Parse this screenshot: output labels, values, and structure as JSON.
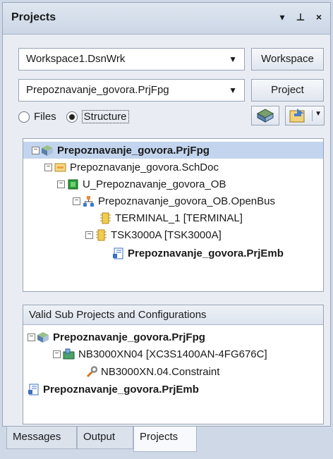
{
  "panel": {
    "title": "Projects",
    "buttons": {
      "menu": "▾",
      "pin": "⊥",
      "close": "×"
    }
  },
  "workspace": {
    "value": "Workspace1.DsnWrk",
    "button": "Workspace"
  },
  "project": {
    "value": "Prepoznavanje_govora.PrjFpg",
    "button": "Project"
  },
  "view": {
    "files_label": "Files",
    "structure_label": "Structure",
    "selected": "Structure"
  },
  "tree": [
    {
      "label": "Prepoznavanje_govora.PrjFpg",
      "bold": true,
      "selected": true,
      "icon": "fpga-project-icon"
    },
    {
      "label": "Prepoznavanje_govora.SchDoc",
      "icon": "schematic-icon"
    },
    {
      "label": "U_Prepoznavanje_govora_OB",
      "icon": "component-icon"
    },
    {
      "label": "Prepoznavanje_govora_OB.OpenBus",
      "icon": "openbus-icon"
    },
    {
      "label": "TERMINAL_1 [TERMINAL]",
      "icon": "terminal-icon"
    },
    {
      "label": "TSK3000A [TSK3000A]",
      "icon": "processor-icon"
    },
    {
      "label": "Prepoznavanje_govora.PrjEmb",
      "bold": true,
      "icon": "embedded-project-icon"
    }
  ],
  "sub": {
    "header": "Valid Sub Projects and Configurations",
    "items": [
      {
        "label": "Prepoznavanje_govora.PrjFpg",
        "bold": true,
        "icon": "fpga-project-icon"
      },
      {
        "label": "NB3000XN04 [XC3S1400AN-4FG676C]",
        "icon": "board-icon"
      },
      {
        "label": "NB3000XN.04.Constraint",
        "icon": "wrench-icon"
      },
      {
        "label": "Prepoznavanje_govora.PrjEmb",
        "bold": true,
        "icon": "embedded-project-icon"
      }
    ]
  },
  "tabs": [
    "Messages",
    "Output",
    "Projects"
  ],
  "active_tab": "Projects"
}
